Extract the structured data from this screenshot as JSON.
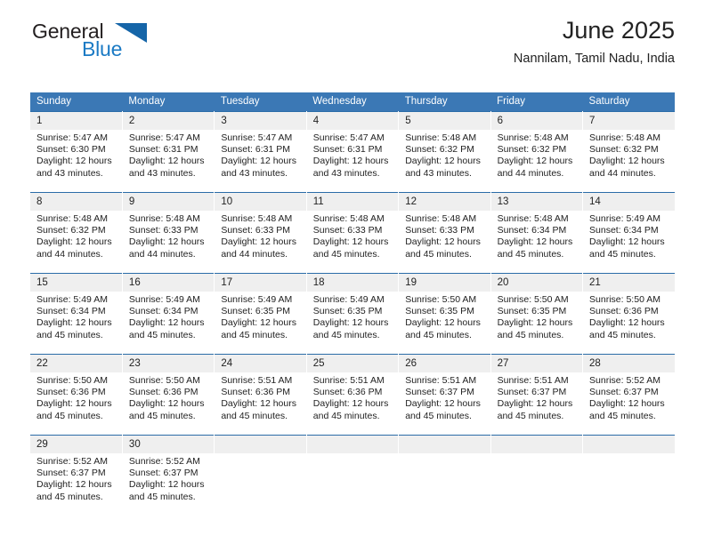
{
  "brand": {
    "name_part1": "General",
    "name_part2": "Blue",
    "logo_icon": "triangle-icon",
    "accent_color": "#1b7ac4",
    "dark_color": "#1565a8"
  },
  "header": {
    "title": "June 2025",
    "subtitle": "Nannilam, Tamil Nadu, India"
  },
  "calendar": {
    "header_bg": "#3b78b5",
    "daynum_bg": "#efefef",
    "weekdays": [
      "Sunday",
      "Monday",
      "Tuesday",
      "Wednesday",
      "Thursday",
      "Friday",
      "Saturday"
    ],
    "weeks": [
      [
        {
          "day": "1",
          "sunrise": "Sunrise: 5:47 AM",
          "sunset": "Sunset: 6:30 PM",
          "daylight_line1": "Daylight: 12 hours",
          "daylight_line2": "and 43 minutes."
        },
        {
          "day": "2",
          "sunrise": "Sunrise: 5:47 AM",
          "sunset": "Sunset: 6:31 PM",
          "daylight_line1": "Daylight: 12 hours",
          "daylight_line2": "and 43 minutes."
        },
        {
          "day": "3",
          "sunrise": "Sunrise: 5:47 AM",
          "sunset": "Sunset: 6:31 PM",
          "daylight_line1": "Daylight: 12 hours",
          "daylight_line2": "and 43 minutes."
        },
        {
          "day": "4",
          "sunrise": "Sunrise: 5:47 AM",
          "sunset": "Sunset: 6:31 PM",
          "daylight_line1": "Daylight: 12 hours",
          "daylight_line2": "and 43 minutes."
        },
        {
          "day": "5",
          "sunrise": "Sunrise: 5:48 AM",
          "sunset": "Sunset: 6:32 PM",
          "daylight_line1": "Daylight: 12 hours",
          "daylight_line2": "and 43 minutes."
        },
        {
          "day": "6",
          "sunrise": "Sunrise: 5:48 AM",
          "sunset": "Sunset: 6:32 PM",
          "daylight_line1": "Daylight: 12 hours",
          "daylight_line2": "and 44 minutes."
        },
        {
          "day": "7",
          "sunrise": "Sunrise: 5:48 AM",
          "sunset": "Sunset: 6:32 PM",
          "daylight_line1": "Daylight: 12 hours",
          "daylight_line2": "and 44 minutes."
        }
      ],
      [
        {
          "day": "8",
          "sunrise": "Sunrise: 5:48 AM",
          "sunset": "Sunset: 6:32 PM",
          "daylight_line1": "Daylight: 12 hours",
          "daylight_line2": "and 44 minutes."
        },
        {
          "day": "9",
          "sunrise": "Sunrise: 5:48 AM",
          "sunset": "Sunset: 6:33 PM",
          "daylight_line1": "Daylight: 12 hours",
          "daylight_line2": "and 44 minutes."
        },
        {
          "day": "10",
          "sunrise": "Sunrise: 5:48 AM",
          "sunset": "Sunset: 6:33 PM",
          "daylight_line1": "Daylight: 12 hours",
          "daylight_line2": "and 44 minutes."
        },
        {
          "day": "11",
          "sunrise": "Sunrise: 5:48 AM",
          "sunset": "Sunset: 6:33 PM",
          "daylight_line1": "Daylight: 12 hours",
          "daylight_line2": "and 45 minutes."
        },
        {
          "day": "12",
          "sunrise": "Sunrise: 5:48 AM",
          "sunset": "Sunset: 6:33 PM",
          "daylight_line1": "Daylight: 12 hours",
          "daylight_line2": "and 45 minutes."
        },
        {
          "day": "13",
          "sunrise": "Sunrise: 5:48 AM",
          "sunset": "Sunset: 6:34 PM",
          "daylight_line1": "Daylight: 12 hours",
          "daylight_line2": "and 45 minutes."
        },
        {
          "day": "14",
          "sunrise": "Sunrise: 5:49 AM",
          "sunset": "Sunset: 6:34 PM",
          "daylight_line1": "Daylight: 12 hours",
          "daylight_line2": "and 45 minutes."
        }
      ],
      [
        {
          "day": "15",
          "sunrise": "Sunrise: 5:49 AM",
          "sunset": "Sunset: 6:34 PM",
          "daylight_line1": "Daylight: 12 hours",
          "daylight_line2": "and 45 minutes."
        },
        {
          "day": "16",
          "sunrise": "Sunrise: 5:49 AM",
          "sunset": "Sunset: 6:34 PM",
          "daylight_line1": "Daylight: 12 hours",
          "daylight_line2": "and 45 minutes."
        },
        {
          "day": "17",
          "sunrise": "Sunrise: 5:49 AM",
          "sunset": "Sunset: 6:35 PM",
          "daylight_line1": "Daylight: 12 hours",
          "daylight_line2": "and 45 minutes."
        },
        {
          "day": "18",
          "sunrise": "Sunrise: 5:49 AM",
          "sunset": "Sunset: 6:35 PM",
          "daylight_line1": "Daylight: 12 hours",
          "daylight_line2": "and 45 minutes."
        },
        {
          "day": "19",
          "sunrise": "Sunrise: 5:50 AM",
          "sunset": "Sunset: 6:35 PM",
          "daylight_line1": "Daylight: 12 hours",
          "daylight_line2": "and 45 minutes."
        },
        {
          "day": "20",
          "sunrise": "Sunrise: 5:50 AM",
          "sunset": "Sunset: 6:35 PM",
          "daylight_line1": "Daylight: 12 hours",
          "daylight_line2": "and 45 minutes."
        },
        {
          "day": "21",
          "sunrise": "Sunrise: 5:50 AM",
          "sunset": "Sunset: 6:36 PM",
          "daylight_line1": "Daylight: 12 hours",
          "daylight_line2": "and 45 minutes."
        }
      ],
      [
        {
          "day": "22",
          "sunrise": "Sunrise: 5:50 AM",
          "sunset": "Sunset: 6:36 PM",
          "daylight_line1": "Daylight: 12 hours",
          "daylight_line2": "and 45 minutes."
        },
        {
          "day": "23",
          "sunrise": "Sunrise: 5:50 AM",
          "sunset": "Sunset: 6:36 PM",
          "daylight_line1": "Daylight: 12 hours",
          "daylight_line2": "and 45 minutes."
        },
        {
          "day": "24",
          "sunrise": "Sunrise: 5:51 AM",
          "sunset": "Sunset: 6:36 PM",
          "daylight_line1": "Daylight: 12 hours",
          "daylight_line2": "and 45 minutes."
        },
        {
          "day": "25",
          "sunrise": "Sunrise: 5:51 AM",
          "sunset": "Sunset: 6:36 PM",
          "daylight_line1": "Daylight: 12 hours",
          "daylight_line2": "and 45 minutes."
        },
        {
          "day": "26",
          "sunrise": "Sunrise: 5:51 AM",
          "sunset": "Sunset: 6:37 PM",
          "daylight_line1": "Daylight: 12 hours",
          "daylight_line2": "and 45 minutes."
        },
        {
          "day": "27",
          "sunrise": "Sunrise: 5:51 AM",
          "sunset": "Sunset: 6:37 PM",
          "daylight_line1": "Daylight: 12 hours",
          "daylight_line2": "and 45 minutes."
        },
        {
          "day": "28",
          "sunrise": "Sunrise: 5:52 AM",
          "sunset": "Sunset: 6:37 PM",
          "daylight_line1": "Daylight: 12 hours",
          "daylight_line2": "and 45 minutes."
        }
      ],
      [
        {
          "day": "29",
          "sunrise": "Sunrise: 5:52 AM",
          "sunset": "Sunset: 6:37 PM",
          "daylight_line1": "Daylight: 12 hours",
          "daylight_line2": "and 45 minutes."
        },
        {
          "day": "30",
          "sunrise": "Sunrise: 5:52 AM",
          "sunset": "Sunset: 6:37 PM",
          "daylight_line1": "Daylight: 12 hours",
          "daylight_line2": "and 45 minutes."
        },
        {
          "day": "",
          "sunrise": "",
          "sunset": "",
          "daylight_line1": "",
          "daylight_line2": ""
        },
        {
          "day": "",
          "sunrise": "",
          "sunset": "",
          "daylight_line1": "",
          "daylight_line2": ""
        },
        {
          "day": "",
          "sunrise": "",
          "sunset": "",
          "daylight_line1": "",
          "daylight_line2": ""
        },
        {
          "day": "",
          "sunrise": "",
          "sunset": "",
          "daylight_line1": "",
          "daylight_line2": ""
        },
        {
          "day": "",
          "sunrise": "",
          "sunset": "",
          "daylight_line1": "",
          "daylight_line2": ""
        }
      ]
    ]
  }
}
